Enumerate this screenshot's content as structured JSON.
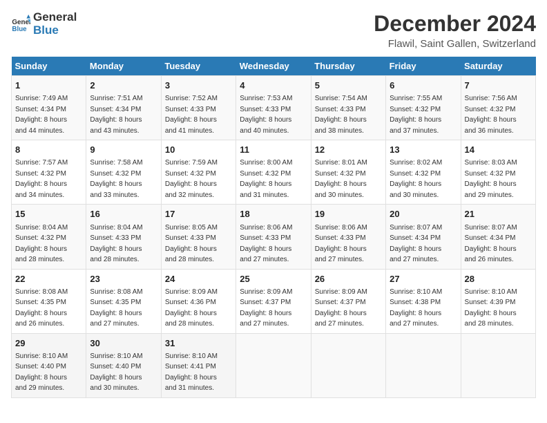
{
  "header": {
    "logo_general": "General",
    "logo_blue": "Blue",
    "title": "December 2024",
    "subtitle": "Flawil, Saint Gallen, Switzerland"
  },
  "days_of_week": [
    "Sunday",
    "Monday",
    "Tuesday",
    "Wednesday",
    "Thursday",
    "Friday",
    "Saturday"
  ],
  "weeks": [
    [
      {
        "day": "1",
        "sunrise": "7:49 AM",
        "sunset": "4:34 PM",
        "daylight": "8 hours and 44 minutes."
      },
      {
        "day": "2",
        "sunrise": "7:51 AM",
        "sunset": "4:34 PM",
        "daylight": "8 hours and 43 minutes."
      },
      {
        "day": "3",
        "sunrise": "7:52 AM",
        "sunset": "4:33 PM",
        "daylight": "8 hours and 41 minutes."
      },
      {
        "day": "4",
        "sunrise": "7:53 AM",
        "sunset": "4:33 PM",
        "daylight": "8 hours and 40 minutes."
      },
      {
        "day": "5",
        "sunrise": "7:54 AM",
        "sunset": "4:33 PM",
        "daylight": "8 hours and 38 minutes."
      },
      {
        "day": "6",
        "sunrise": "7:55 AM",
        "sunset": "4:32 PM",
        "daylight": "8 hours and 37 minutes."
      },
      {
        "day": "7",
        "sunrise": "7:56 AM",
        "sunset": "4:32 PM",
        "daylight": "8 hours and 36 minutes."
      }
    ],
    [
      {
        "day": "8",
        "sunrise": "7:57 AM",
        "sunset": "4:32 PM",
        "daylight": "8 hours and 34 minutes."
      },
      {
        "day": "9",
        "sunrise": "7:58 AM",
        "sunset": "4:32 PM",
        "daylight": "8 hours and 33 minutes."
      },
      {
        "day": "10",
        "sunrise": "7:59 AM",
        "sunset": "4:32 PM",
        "daylight": "8 hours and 32 minutes."
      },
      {
        "day": "11",
        "sunrise": "8:00 AM",
        "sunset": "4:32 PM",
        "daylight": "8 hours and 31 minutes."
      },
      {
        "day": "12",
        "sunrise": "8:01 AM",
        "sunset": "4:32 PM",
        "daylight": "8 hours and 30 minutes."
      },
      {
        "day": "13",
        "sunrise": "8:02 AM",
        "sunset": "4:32 PM",
        "daylight": "8 hours and 30 minutes."
      },
      {
        "day": "14",
        "sunrise": "8:03 AM",
        "sunset": "4:32 PM",
        "daylight": "8 hours and 29 minutes."
      }
    ],
    [
      {
        "day": "15",
        "sunrise": "8:04 AM",
        "sunset": "4:32 PM",
        "daylight": "8 hours and 28 minutes."
      },
      {
        "day": "16",
        "sunrise": "8:04 AM",
        "sunset": "4:33 PM",
        "daylight": "8 hours and 28 minutes."
      },
      {
        "day": "17",
        "sunrise": "8:05 AM",
        "sunset": "4:33 PM",
        "daylight": "8 hours and 28 minutes."
      },
      {
        "day": "18",
        "sunrise": "8:06 AM",
        "sunset": "4:33 PM",
        "daylight": "8 hours and 27 minutes."
      },
      {
        "day": "19",
        "sunrise": "8:06 AM",
        "sunset": "4:33 PM",
        "daylight": "8 hours and 27 minutes."
      },
      {
        "day": "20",
        "sunrise": "8:07 AM",
        "sunset": "4:34 PM",
        "daylight": "8 hours and 27 minutes."
      },
      {
        "day": "21",
        "sunrise": "8:07 AM",
        "sunset": "4:34 PM",
        "daylight": "8 hours and 26 minutes."
      }
    ],
    [
      {
        "day": "22",
        "sunrise": "8:08 AM",
        "sunset": "4:35 PM",
        "daylight": "8 hours and 26 minutes."
      },
      {
        "day": "23",
        "sunrise": "8:08 AM",
        "sunset": "4:35 PM",
        "daylight": "8 hours and 27 minutes."
      },
      {
        "day": "24",
        "sunrise": "8:09 AM",
        "sunset": "4:36 PM",
        "daylight": "8 hours and 28 minutes."
      },
      {
        "day": "25",
        "sunrise": "8:09 AM",
        "sunset": "4:37 PM",
        "daylight": "8 hours and 27 minutes."
      },
      {
        "day": "26",
        "sunrise": "8:09 AM",
        "sunset": "4:37 PM",
        "daylight": "8 hours and 27 minutes."
      },
      {
        "day": "27",
        "sunrise": "8:10 AM",
        "sunset": "4:38 PM",
        "daylight": "8 hours and 27 minutes."
      },
      {
        "day": "28",
        "sunrise": "8:10 AM",
        "sunset": "4:39 PM",
        "daylight": "8 hours and 28 minutes."
      }
    ],
    [
      {
        "day": "29",
        "sunrise": "8:10 AM",
        "sunset": "4:40 PM",
        "daylight": "8 hours and 29 minutes."
      },
      {
        "day": "30",
        "sunrise": "8:10 AM",
        "sunset": "4:40 PM",
        "daylight": "8 hours and 30 minutes."
      },
      {
        "day": "31",
        "sunrise": "8:10 AM",
        "sunset": "4:41 PM",
        "daylight": "8 hours and 31 minutes."
      },
      null,
      null,
      null,
      null
    ]
  ],
  "labels": {
    "sunrise": "Sunrise:",
    "sunset": "Sunset:",
    "daylight": "Daylight:"
  }
}
